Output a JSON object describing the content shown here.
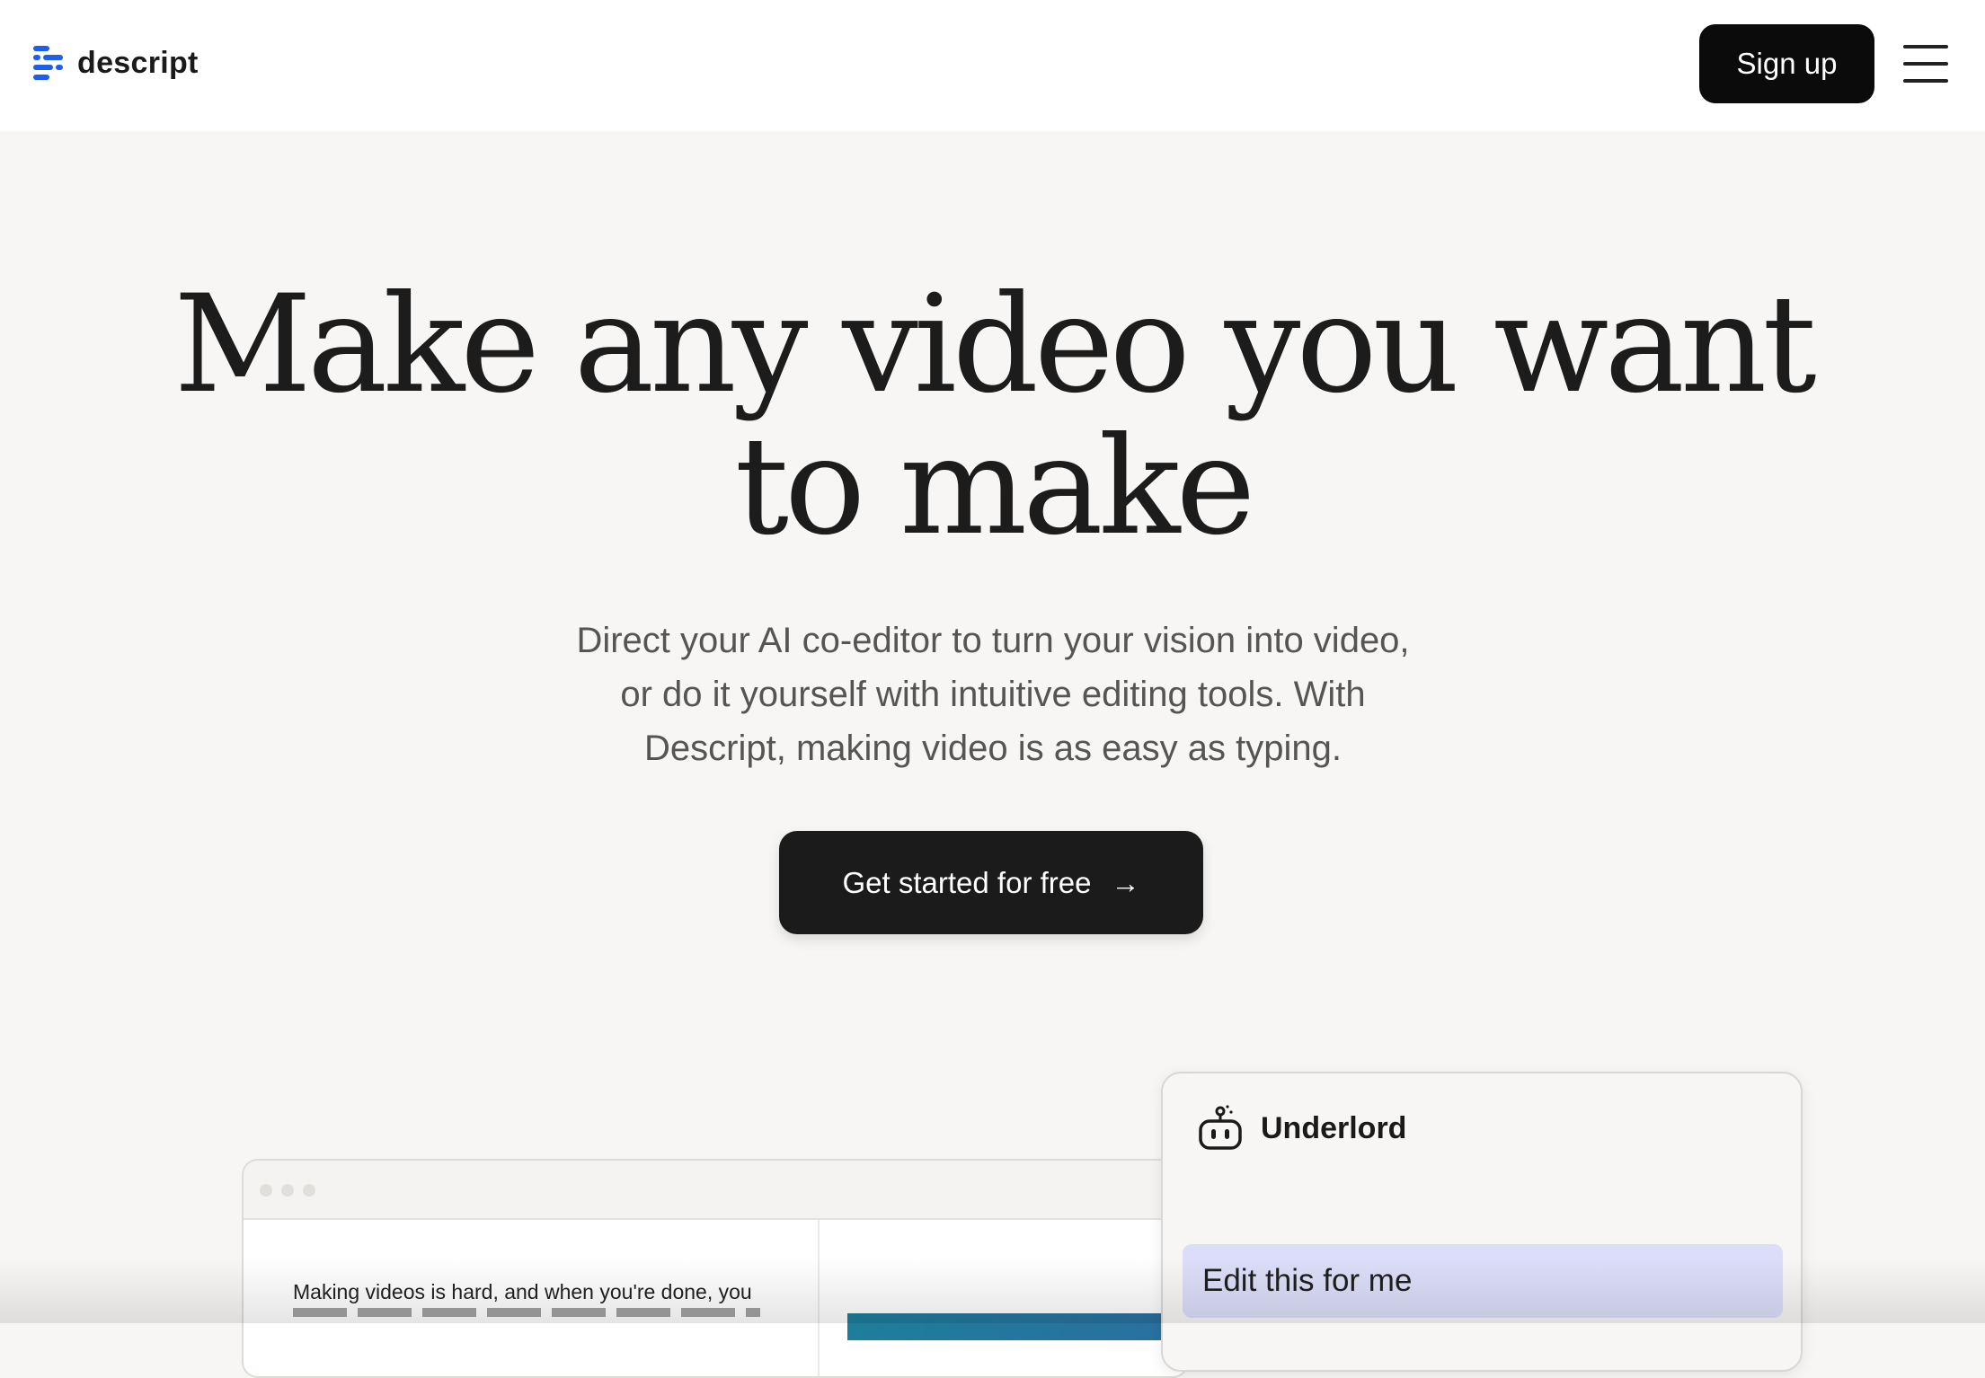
{
  "header": {
    "logo_text": "descript",
    "logo_icon": "descript-logo-icon",
    "signup_label": "Sign up",
    "menu_icon": "hamburger-menu-icon"
  },
  "hero": {
    "headline_line1": "Make any video you want",
    "headline_line2": "to make",
    "subhead_line1": "Direct your AI co-editor to turn your vision into video,",
    "subhead_line2": "or do it yourself with intuitive editing tools. With",
    "subhead_line3": "Descript, making video is as easy as typing.",
    "cta_label": "Get started for free",
    "cta_icon": "arrow-right-icon"
  },
  "app_preview": {
    "transcript_text": "Making videos is hard, and when you're done, you"
  },
  "underlord_panel": {
    "title": "Underlord",
    "icon": "robot-icon",
    "suggestion": "Edit this for me"
  },
  "colors": {
    "page_bg": "#f7f6f4",
    "header_bg": "#ffffff",
    "button_dark": "#0b0b0b",
    "brand_blue": "#1f5eea",
    "chip_bg": "#dcddf8"
  }
}
